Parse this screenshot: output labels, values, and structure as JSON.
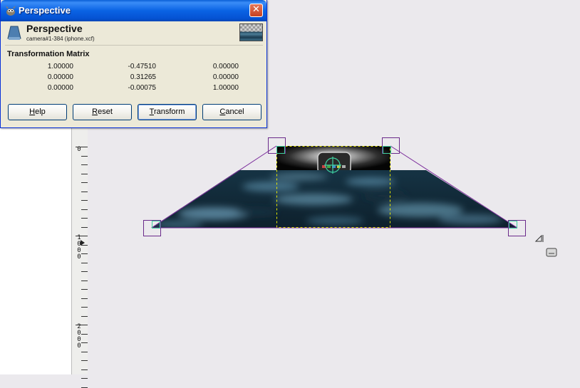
{
  "dialog": {
    "title": "Perspective",
    "heading": "Perspective",
    "subheading": "camera#1-384 (iphone.xcf)",
    "section_title": "Transformation Matrix",
    "matrix": [
      [
        "1.00000",
        "-0.47510",
        "0.00000"
      ],
      [
        "0.00000",
        "0.31265",
        "0.00000"
      ],
      [
        "0.00000",
        "-0.00075",
        "1.00000"
      ]
    ],
    "buttons": {
      "help": {
        "mnemonic": "H",
        "rest": "elp"
      },
      "reset": {
        "mnemonic": "R",
        "rest": "eset"
      },
      "transform": {
        "mnemonic": "T",
        "rest": "ransform"
      },
      "cancel": {
        "mnemonic": "C",
        "rest": "ancel"
      }
    },
    "close_label": "✕",
    "icons": {
      "title": "gimp-icon",
      "tool": "perspective-tool-icon",
      "preview": "layer-preview-icon"
    }
  },
  "ruler": {
    "labels": [
      {
        "digits": [
          "0"
        ]
      },
      {
        "digits": [
          "1",
          "0",
          "0",
          "0"
        ]
      },
      {
        "digits": [
          "2",
          "0",
          "0",
          "0"
        ]
      }
    ]
  },
  "colors": {
    "titlebar": "#0a63e4",
    "dialog_bg": "#ece9d8",
    "canvas_bg": "#ebe9ed",
    "handle": "#6a2a8a",
    "guide": "#7a2a9a",
    "selection": "#e8e800",
    "water_dark": "#0f2533",
    "water_light": "#5f91ab"
  },
  "side_icons": [
    "resize-corner-icon",
    "navigate-icon"
  ]
}
